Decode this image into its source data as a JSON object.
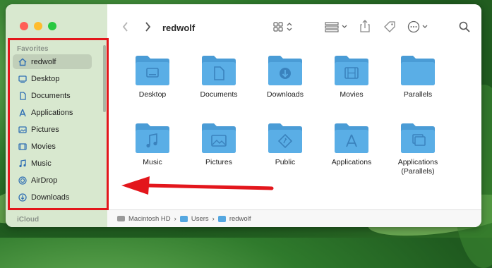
{
  "window": {
    "title": "redwolf",
    "traffic_lights": {
      "close": "#ff5f57",
      "minimize": "#febc2e",
      "zoom": "#28c840"
    }
  },
  "sidebar": {
    "section_favorites": "Favorites",
    "section_icloud": "iCloud",
    "items": [
      {
        "label": "redwolf",
        "icon": "home-icon",
        "selected": true
      },
      {
        "label": "Desktop",
        "icon": "desktop-icon"
      },
      {
        "label": "Documents",
        "icon": "document-icon"
      },
      {
        "label": "Applications",
        "icon": "applications-icon"
      },
      {
        "label": "Pictures",
        "icon": "pictures-icon"
      },
      {
        "label": "Movies",
        "icon": "movies-icon"
      },
      {
        "label": "Music",
        "icon": "music-icon"
      },
      {
        "label": "AirDrop",
        "icon": "airdrop-icon"
      },
      {
        "label": "Downloads",
        "icon": "downloads-icon"
      }
    ]
  },
  "folders": [
    {
      "label": "Desktop",
      "icon": "desktop"
    },
    {
      "label": "Documents",
      "icon": "document"
    },
    {
      "label": "Downloads",
      "icon": "download"
    },
    {
      "label": "Movies",
      "icon": "movie"
    },
    {
      "label": "Parallels",
      "icon": "plain"
    },
    {
      "label": "Music",
      "icon": "music"
    },
    {
      "label": "Pictures",
      "icon": "picture"
    },
    {
      "label": "Public",
      "icon": "public"
    },
    {
      "label": "Applications",
      "icon": "apps"
    },
    {
      "label": "Applications (Parallels)",
      "icon": "parallels"
    }
  ],
  "pathbar": [
    "Macintosh HD",
    "Users",
    "redwolf"
  ],
  "colors": {
    "folder": "#5aaee6",
    "folder_tab": "#4a9cd6",
    "folder_glyph": "#3a82bd",
    "annotation": "#e3161c"
  }
}
